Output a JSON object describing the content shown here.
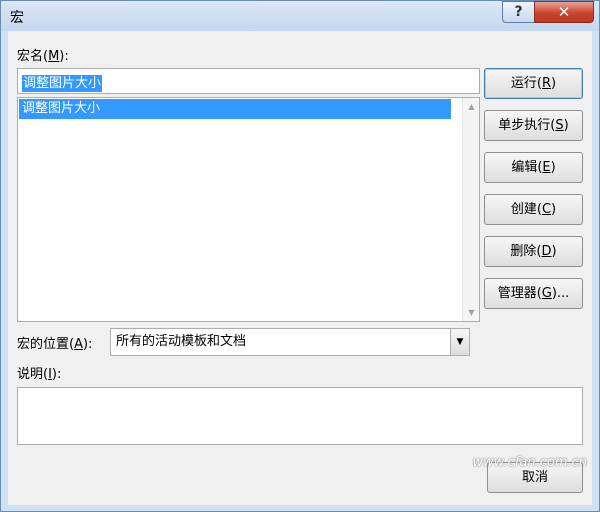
{
  "window": {
    "title": "宏",
    "help_glyph": "?",
    "close_glyph": "✕"
  },
  "macro_name": {
    "label_prefix": "宏名(",
    "label_key": "M",
    "label_suffix": "):",
    "value": "调整图片大小"
  },
  "macro_list": {
    "items": [
      "调整图片大小"
    ],
    "selected_index": 0
  },
  "buttons": [
    {
      "name": "run-button",
      "prefix": "运行(",
      "key": "R",
      "suffix": ")"
    },
    {
      "name": "step-into-button",
      "prefix": "单步执行(",
      "key": "S",
      "suffix": ")"
    },
    {
      "name": "edit-button",
      "prefix": "编辑(",
      "key": "E",
      "suffix": ")"
    },
    {
      "name": "create-button",
      "prefix": "创建(",
      "key": "C",
      "suffix": ")"
    },
    {
      "name": "delete-button",
      "prefix": "删除(",
      "key": "D",
      "suffix": ")"
    },
    {
      "name": "organizer-button",
      "prefix": "管理器(",
      "key": "G",
      "suffix": ")..."
    }
  ],
  "location": {
    "label_prefix": "宏的位置(",
    "label_key": "A",
    "label_suffix": "):",
    "selected": "所有的活动模板和文档"
  },
  "description": {
    "label_prefix": "说明(",
    "label_key": "I",
    "label_suffix": "):",
    "value": ""
  },
  "cancel_label": "取消",
  "watermark": "www.cfan.com.cn"
}
